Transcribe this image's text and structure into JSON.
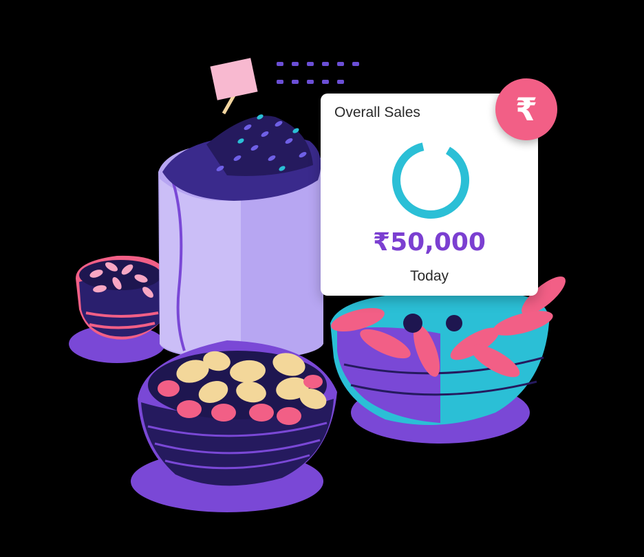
{
  "card": {
    "title": "Overall Sales",
    "amount": "₹50,000",
    "period": "Today",
    "progress": 0.88,
    "progress_color": "#2bbfd6",
    "amount_color": "#7b3fd1"
  },
  "badge": {
    "symbol": "₹",
    "color": "#f25f86"
  },
  "palette": {
    "purple": "#7a48d6",
    "lavender": "#b7a6f2",
    "navy": "#251a5e",
    "pink": "#f25f86",
    "cyan": "#2bbfd6",
    "cream": "#f3d79a"
  }
}
